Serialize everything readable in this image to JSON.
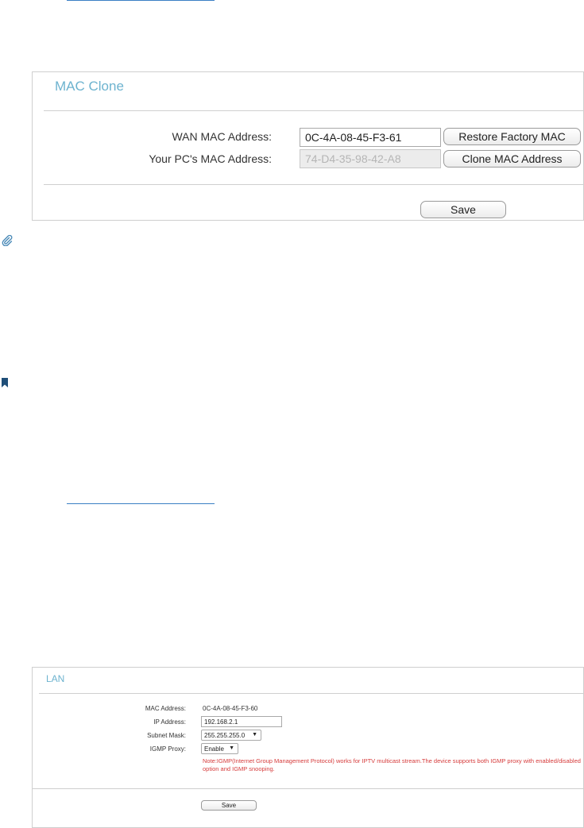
{
  "icons": {
    "note": "paperclip-icon",
    "tip": "bookmark-icon"
  },
  "colors": {
    "panel_title": "#6db3cf",
    "note_text": "#d63b3b",
    "link_rule": "#3a7fc4"
  },
  "mac_clone": {
    "title": "MAC Clone",
    "wan_mac_label": "WAN MAC Address:",
    "wan_mac_value": "0C-4A-08-45-F3-61",
    "restore_button": "Restore Factory MAC",
    "pc_mac_label": "Your PC's MAC Address:",
    "pc_mac_value": "74-D4-35-98-42-A8",
    "clone_button": "Clone MAC Address",
    "save_button": "Save"
  },
  "lan": {
    "title": "LAN",
    "mac_label": "MAC Address:",
    "mac_value": "0C-4A-08-45-F3-60",
    "ip_label": "IP Address:",
    "ip_value": "192.168.2.1",
    "subnet_label": "Subnet Mask:",
    "subnet_value": "255.255.255.0",
    "igmp_label": "IGMP Proxy:",
    "igmp_value": "Enable",
    "note": "Note:IGMP(Internet Group Management Protocol) works for IPTV multicast stream.The device supports both IGMP proxy with enabled/disabled option and IGMP snooping.",
    "save_button": "Save"
  }
}
